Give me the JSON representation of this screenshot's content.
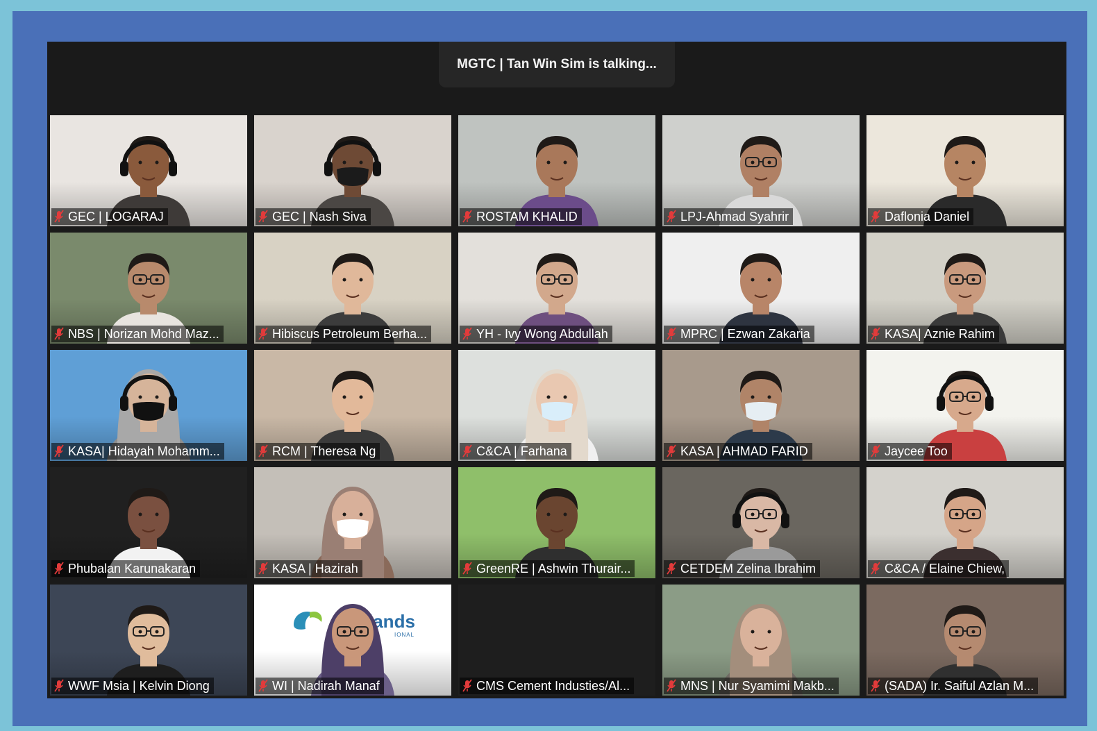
{
  "meeting": {
    "speaker_banner": "MGTC | Tan Win Sim is talking..."
  },
  "participants": [
    {
      "name": "GEC | LOGARAJ",
      "bg": "#e9e5e1",
      "skin": "#8a5a3c",
      "shirt": "#3e3a38",
      "headphones": true,
      "muted": true
    },
    {
      "name": "GEC | Nash Siva",
      "bg": "#d9d3cd",
      "skin": "#6e4a35",
      "shirt": "#4b4744",
      "headphones": true,
      "mask": "#1b1b1b",
      "muted": true
    },
    {
      "name": "ROSTAM KHALID",
      "bg": "#bfc3c0",
      "skin": "#a9785a",
      "shirt": "#6b4c8a",
      "muted": true
    },
    {
      "name": "LPJ-Ahmad Syahrir",
      "bg": "#cfd0cd",
      "skin": "#b08064",
      "shirt": "#d9d9d9",
      "glasses": true,
      "muted": true
    },
    {
      "name": "Daflonia Daniel",
      "bg": "#ece7dc",
      "skin": "#b68563",
      "shirt": "#2a2a2a",
      "muted": true
    },
    {
      "name": "NBS | Norizan Mohd Maz...",
      "bg": "#7a8a6c",
      "skin": "#b88a6c",
      "shirt": "#e8e4df",
      "glasses": true,
      "muted": true
    },
    {
      "name": "Hibiscus Petroleum Berha...",
      "bg": "#d8d2c4",
      "skin": "#e0b89a",
      "shirt": "#3c3c3c",
      "muted": true
    },
    {
      "name": "YH - Ivy Wong Abdullah",
      "bg": "#e3e0db",
      "skin": "#d2a88c",
      "shirt": "#6e4f7f",
      "glasses": true,
      "muted": true
    },
    {
      "name": "MPRC | Ezwan Zakaria",
      "bg": "#efefef",
      "skin": "#b88568",
      "shirt": "#2e3440",
      "muted": true
    },
    {
      "name": "KASA| Aznie Rahim",
      "bg": "#d3d1c8",
      "skin": "#c99a7e",
      "shirt": "#3a3a3a",
      "glasses": true,
      "muted": true
    },
    {
      "name": "KASA| Hidayah Mohamm...",
      "bg": "#5f9fd6",
      "skin": "#d6b49a",
      "shirt": "#8d8d8d",
      "headphones": true,
      "mask": "#111111",
      "hijab": "#a8a8a8",
      "muted": true
    },
    {
      "name": "RCM | Theresa Ng",
      "bg": "#c9b8a6",
      "skin": "#e2b99a",
      "shirt": "#3a3a3a",
      "muted": true
    },
    {
      "name": "C&CA | Farhana",
      "bg": "#dde0dd",
      "skin": "#e9c8b1",
      "shirt": "#f0f0f0",
      "mask": "#d9eefa",
      "hijab": "#e3d9cc",
      "muted": true
    },
    {
      "name": "KASA | AHMAD FARID",
      "bg": "#a89a8c",
      "skin": "#b08468",
      "shirt": "#2c3a4a",
      "mask": "#e6eef3",
      "muted": true
    },
    {
      "name": "Jaycee Too",
      "bg": "#f3f3ee",
      "skin": "#d7a98c",
      "shirt": "#c94040",
      "headphones": true,
      "glasses": true,
      "muted": true
    },
    {
      "name": "Phubalan Karunakaran",
      "bg": "#202020",
      "skin": "#7a5040",
      "shirt": "#f2f2f2",
      "muted": true
    },
    {
      "name": "KASA | Hazirah",
      "bg": "#c4bfb8",
      "skin": "#d8b09a",
      "shirt": "#8a6a5a",
      "mask": "#ffffff",
      "hijab": "#9a7f74",
      "muted": true
    },
    {
      "name": "GreenRE | Ashwin Thurair...",
      "bg": "#8fbf6a",
      "skin": "#6a4530",
      "shirt": "#2f2f2f",
      "muted": true
    },
    {
      "name": "CETDEM Zelina Ibrahim",
      "bg": "#6a665f",
      "skin": "#d9b8a5",
      "shirt": "#9a9a9a",
      "headphones": true,
      "glasses": true,
      "muted": true
    },
    {
      "name": "C&CA / Elaine Chiew,",
      "bg": "#d4d2cc",
      "skin": "#d5a588",
      "shirt": "#3b2f2f",
      "glasses": true,
      "muted": true
    },
    {
      "name": "WWF Msia | Kelvin Diong",
      "bg": "#3d4656",
      "skin": "#e0bc9c",
      "shirt": "#1e1e1e",
      "glasses": true,
      "muted": true
    },
    {
      "name": "WI | Nadirah Manaf",
      "bg": "#ffffff",
      "skin": "#c9977a",
      "shirt": "#6b5f88",
      "hijab": "#4d3f67",
      "glasses": true,
      "logo": "lands",
      "logo_sub": "IONAL",
      "muted": true
    },
    {
      "name": "CMS Cement Industies/Al...",
      "empty": true,
      "muted": true
    },
    {
      "name": "MNS | Nur Syamimi Makb...",
      "bg": "#8b9c86",
      "skin": "#d9b29b",
      "shirt": "#6f6a64",
      "hijab": "#a38e7c",
      "muted": true
    },
    {
      "name": "(SADA) Ir. Saiful Azlan M...",
      "bg": "#7b6a60",
      "skin": "#b58a70",
      "shirt": "#303030",
      "glasses": true,
      "muted": true
    }
  ]
}
